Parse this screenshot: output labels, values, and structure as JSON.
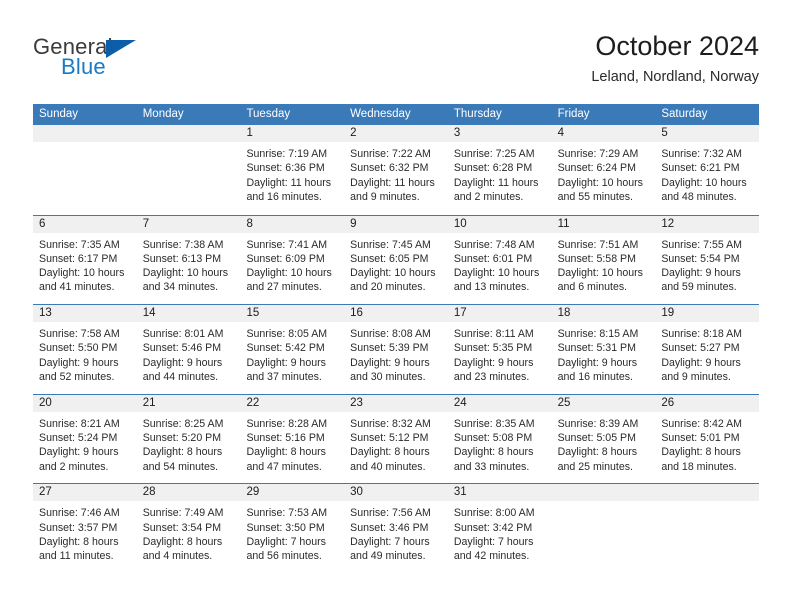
{
  "brand": {
    "name_part1": "General",
    "name_part2": "Blue",
    "triangle_color": "#0d5ea8",
    "blue_color": "#1a7bc4"
  },
  "header": {
    "title": "October 2024",
    "subtitle": "Leland, Nordland, Norway"
  },
  "colors": {
    "header_band": "#3a7ab8",
    "row_divider": "#3a7ab8",
    "day_number_strip": "#f0f0f0",
    "text": "#2b2b2b"
  },
  "weekdays": [
    "Sunday",
    "Monday",
    "Tuesday",
    "Wednesday",
    "Thursday",
    "Friday",
    "Saturday"
  ],
  "weeks": [
    [
      {
        "day": "",
        "lines": [
          "",
          "",
          "",
          ""
        ]
      },
      {
        "day": "",
        "lines": [
          "",
          "",
          "",
          ""
        ]
      },
      {
        "day": "1",
        "lines": [
          "Sunrise: 7:19 AM",
          "Sunset: 6:36 PM",
          "Daylight: 11 hours",
          "and 16 minutes."
        ]
      },
      {
        "day": "2",
        "lines": [
          "Sunrise: 7:22 AM",
          "Sunset: 6:32 PM",
          "Daylight: 11 hours",
          "and 9 minutes."
        ]
      },
      {
        "day": "3",
        "lines": [
          "Sunrise: 7:25 AM",
          "Sunset: 6:28 PM",
          "Daylight: 11 hours",
          "and 2 minutes."
        ]
      },
      {
        "day": "4",
        "lines": [
          "Sunrise: 7:29 AM",
          "Sunset: 6:24 PM",
          "Daylight: 10 hours",
          "and 55 minutes."
        ]
      },
      {
        "day": "5",
        "lines": [
          "Sunrise: 7:32 AM",
          "Sunset: 6:21 PM",
          "Daylight: 10 hours",
          "and 48 minutes."
        ]
      }
    ],
    [
      {
        "day": "6",
        "lines": [
          "Sunrise: 7:35 AM",
          "Sunset: 6:17 PM",
          "Daylight: 10 hours",
          "and 41 minutes."
        ]
      },
      {
        "day": "7",
        "lines": [
          "Sunrise: 7:38 AM",
          "Sunset: 6:13 PM",
          "Daylight: 10 hours",
          "and 34 minutes."
        ]
      },
      {
        "day": "8",
        "lines": [
          "Sunrise: 7:41 AM",
          "Sunset: 6:09 PM",
          "Daylight: 10 hours",
          "and 27 minutes."
        ]
      },
      {
        "day": "9",
        "lines": [
          "Sunrise: 7:45 AM",
          "Sunset: 6:05 PM",
          "Daylight: 10 hours",
          "and 20 minutes."
        ]
      },
      {
        "day": "10",
        "lines": [
          "Sunrise: 7:48 AM",
          "Sunset: 6:01 PM",
          "Daylight: 10 hours",
          "and 13 minutes."
        ]
      },
      {
        "day": "11",
        "lines": [
          "Sunrise: 7:51 AM",
          "Sunset: 5:58 PM",
          "Daylight: 10 hours",
          "and 6 minutes."
        ]
      },
      {
        "day": "12",
        "lines": [
          "Sunrise: 7:55 AM",
          "Sunset: 5:54 PM",
          "Daylight: 9 hours",
          "and 59 minutes."
        ]
      }
    ],
    [
      {
        "day": "13",
        "lines": [
          "Sunrise: 7:58 AM",
          "Sunset: 5:50 PM",
          "Daylight: 9 hours",
          "and 52 minutes."
        ]
      },
      {
        "day": "14",
        "lines": [
          "Sunrise: 8:01 AM",
          "Sunset: 5:46 PM",
          "Daylight: 9 hours",
          "and 44 minutes."
        ]
      },
      {
        "day": "15",
        "lines": [
          "Sunrise: 8:05 AM",
          "Sunset: 5:42 PM",
          "Daylight: 9 hours",
          "and 37 minutes."
        ]
      },
      {
        "day": "16",
        "lines": [
          "Sunrise: 8:08 AM",
          "Sunset: 5:39 PM",
          "Daylight: 9 hours",
          "and 30 minutes."
        ]
      },
      {
        "day": "17",
        "lines": [
          "Sunrise: 8:11 AM",
          "Sunset: 5:35 PM",
          "Daylight: 9 hours",
          "and 23 minutes."
        ]
      },
      {
        "day": "18",
        "lines": [
          "Sunrise: 8:15 AM",
          "Sunset: 5:31 PM",
          "Daylight: 9 hours",
          "and 16 minutes."
        ]
      },
      {
        "day": "19",
        "lines": [
          "Sunrise: 8:18 AM",
          "Sunset: 5:27 PM",
          "Daylight: 9 hours",
          "and 9 minutes."
        ]
      }
    ],
    [
      {
        "day": "20",
        "lines": [
          "Sunrise: 8:21 AM",
          "Sunset: 5:24 PM",
          "Daylight: 9 hours",
          "and 2 minutes."
        ]
      },
      {
        "day": "21",
        "lines": [
          "Sunrise: 8:25 AM",
          "Sunset: 5:20 PM",
          "Daylight: 8 hours",
          "and 54 minutes."
        ]
      },
      {
        "day": "22",
        "lines": [
          "Sunrise: 8:28 AM",
          "Sunset: 5:16 PM",
          "Daylight: 8 hours",
          "and 47 minutes."
        ]
      },
      {
        "day": "23",
        "lines": [
          "Sunrise: 8:32 AM",
          "Sunset: 5:12 PM",
          "Daylight: 8 hours",
          "and 40 minutes."
        ]
      },
      {
        "day": "24",
        "lines": [
          "Sunrise: 8:35 AM",
          "Sunset: 5:08 PM",
          "Daylight: 8 hours",
          "and 33 minutes."
        ]
      },
      {
        "day": "25",
        "lines": [
          "Sunrise: 8:39 AM",
          "Sunset: 5:05 PM",
          "Daylight: 8 hours",
          "and 25 minutes."
        ]
      },
      {
        "day": "26",
        "lines": [
          "Sunrise: 8:42 AM",
          "Sunset: 5:01 PM",
          "Daylight: 8 hours",
          "and 18 minutes."
        ]
      }
    ],
    [
      {
        "day": "27",
        "lines": [
          "Sunrise: 7:46 AM",
          "Sunset: 3:57 PM",
          "Daylight: 8 hours",
          "and 11 minutes."
        ]
      },
      {
        "day": "28",
        "lines": [
          "Sunrise: 7:49 AM",
          "Sunset: 3:54 PM",
          "Daylight: 8 hours",
          "and 4 minutes."
        ]
      },
      {
        "day": "29",
        "lines": [
          "Sunrise: 7:53 AM",
          "Sunset: 3:50 PM",
          "Daylight: 7 hours",
          "and 56 minutes."
        ]
      },
      {
        "day": "30",
        "lines": [
          "Sunrise: 7:56 AM",
          "Sunset: 3:46 PM",
          "Daylight: 7 hours",
          "and 49 minutes."
        ]
      },
      {
        "day": "31",
        "lines": [
          "Sunrise: 8:00 AM",
          "Sunset: 3:42 PM",
          "Daylight: 7 hours",
          "and 42 minutes."
        ]
      },
      {
        "day": "",
        "lines": [
          "",
          "",
          "",
          ""
        ]
      },
      {
        "day": "",
        "lines": [
          "",
          "",
          "",
          ""
        ]
      }
    ]
  ]
}
